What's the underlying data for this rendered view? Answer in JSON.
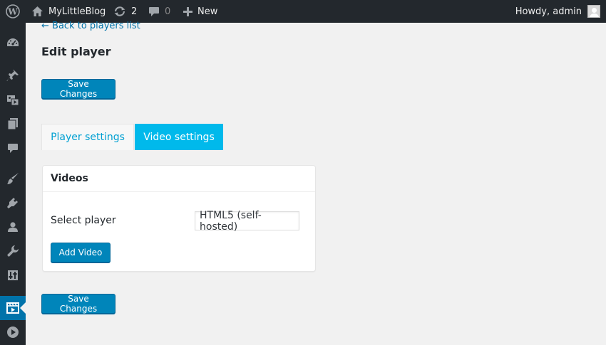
{
  "adminbar": {
    "site_name": "MyLittleBlog",
    "updates_count": "2",
    "comments_count": "0",
    "new_label": "New",
    "greeting": "Howdy, admin",
    "icons": [
      "wordpress-logo-icon",
      "home-icon",
      "updates-icon",
      "comments-icon",
      "plus-icon",
      "avatar"
    ]
  },
  "sidebar": {
    "items": [
      {
        "name": "dashboard-icon"
      },
      {
        "name": "posts-pin-icon"
      },
      {
        "name": "media-icon"
      },
      {
        "name": "pages-icon"
      },
      {
        "name": "comments-icon"
      },
      {
        "name": "appearance-brush-icon"
      },
      {
        "name": "plugins-icon"
      },
      {
        "name": "users-icon"
      },
      {
        "name": "tools-wrench-icon"
      },
      {
        "name": "settings-icon"
      },
      {
        "name": "video-player-icon",
        "active": true
      },
      {
        "name": "play-circle-icon"
      }
    ]
  },
  "content": {
    "back_link": "← Back to players list",
    "page_title": "Edit player",
    "save_button": "Save Changes",
    "tabs": [
      {
        "label": "Player settings",
        "active": false
      },
      {
        "label": "Video settings",
        "active": true
      }
    ],
    "panel": {
      "title": "Videos",
      "select_label": "Select player",
      "select_value": "HTML5 (self-hosted)",
      "add_button": "Add Video"
    }
  },
  "colors": {
    "adminbar_bg": "#23282d",
    "primary_button": "#0085ba",
    "active_tab": "#00b9eb",
    "link": "#0073aa",
    "active_menu": "#0073aa"
  }
}
